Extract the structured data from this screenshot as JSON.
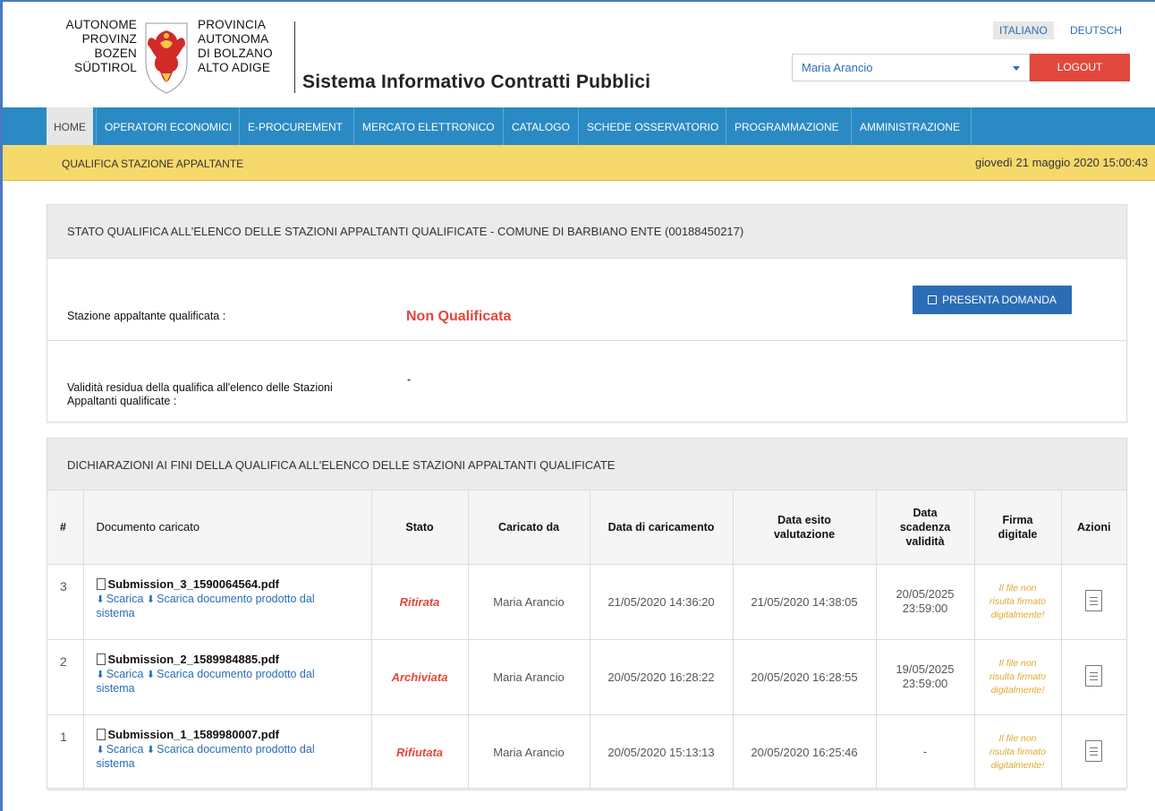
{
  "logo": {
    "left_lines": [
      "AUTONOME",
      "PROVINZ",
      "BOZEN",
      "SÜDTIROL"
    ],
    "right_lines": [
      "PROVINCIA",
      "AUTONOMA",
      "DI BOLZANO",
      "ALTO ADIGE"
    ]
  },
  "system_title": "Sistema Informativo Contratti Pubblici",
  "languages": {
    "it": "ITALIANO",
    "de": "DEUTSCH"
  },
  "user": {
    "name": "Maria Arancio",
    "logout_label": "LOGOUT"
  },
  "nav": {
    "items": [
      "HOME",
      "OPERATORI ECONOMICI",
      "E-PROCUREMENT",
      "MERCATO ELETTRONICO",
      "CATALOGO",
      "SCHEDE OSSERVATORIO",
      "PROGRAMMAZIONE",
      "AMMINISTRAZIONE"
    ]
  },
  "subbar": {
    "section": "QUALIFICA STAZIONE APPALTANTE",
    "datetime": "giovedì 21 maggio 2020 15:00:43"
  },
  "stato_panel": {
    "title": "STATO QUALIFICA ALL'ELENCO DELLE STAZIONI APPALTANTI QUALIFICATE - COMUNE DI BARBIANO ENTE (00188450217)",
    "qualificata_label": "Stazione appaltante qualificata :",
    "qualificata_value": "Non Qualificata",
    "presenta_label": "PRESENTA DOMANDA",
    "validita_label_1": "Validità residua della qualifica all'elenco delle Stazioni",
    "validita_label_2": "Appaltanti qualificate :",
    "validita_value": "-"
  },
  "dich_panel": {
    "title": "DICHIARAZIONI AI FINI DELLA QUALIFICA ALL'ELENCO DELLE STAZIONI APPALTANTI QUALIFICATE",
    "headers": {
      "num": "#",
      "doc": "Documento caricato",
      "stato": "Stato",
      "caricato": "Caricato da",
      "data_car": "Data di caricamento",
      "esito_1": "Data esito",
      "esito_2": "valutazione",
      "scad_1": "Data",
      "scad_2": "scadenza",
      "scad_3": "validità",
      "firma_1": "Firma",
      "firma_2": "digitale",
      "azioni": "Azioni"
    },
    "link_scarica": "Scarica",
    "link_prodotto_1": "Scarica documento prodotto dal",
    "link_prodotto_2": "sistema",
    "firma_text_1": "Il file non",
    "firma_text_2": "risulta firmato",
    "firma_text_3": "digitalmente!",
    "rows": [
      {
        "num": "3",
        "file": "Submission_3_1590064564.pdf",
        "stato": "Ritirata",
        "caricato": "Maria Arancio",
        "data_car": "21/05/2020 14:36:20",
        "esito": "21/05/2020 14:38:05",
        "scad_date": "20/05/2025",
        "scad_time": "23:59:00"
      },
      {
        "num": "2",
        "file": "Submission_2_1589984885.pdf",
        "stato": "Archiviata",
        "caricato": "Maria Arancio",
        "data_car": "20/05/2020 16:28:22",
        "esito": "20/05/2020 16:28:55",
        "scad_date": "19/05/2025",
        "scad_time": "23:59:00"
      },
      {
        "num": "1",
        "file": "Submission_1_1589980007.pdf",
        "stato": "Rifiutata",
        "caricato": "Maria Arancio",
        "data_car": "20/05/2020 15:13:13",
        "esito": "20/05/2020 16:25:46",
        "scad_date": "-",
        "scad_time": ""
      }
    ]
  },
  "colors": {
    "nav_blue": "#2b8ac4",
    "subbar_yellow": "#f6d96b",
    "danger_red": "#e2473c",
    "link_blue": "#2a6db5",
    "warning_orange": "#e0a830"
  }
}
